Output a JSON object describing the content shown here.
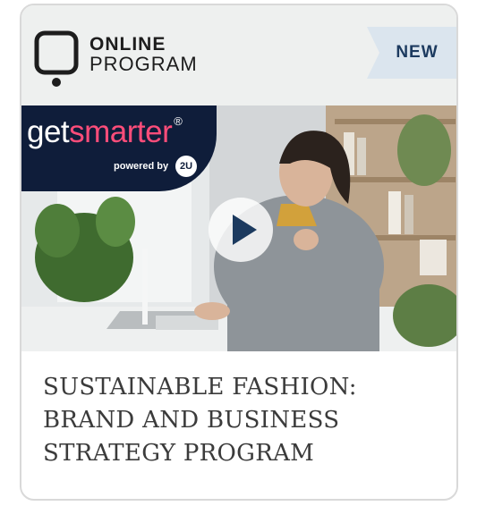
{
  "card": {
    "program_type_line1": "ONLINE",
    "program_type_line2": "PROGRAM",
    "badge": "NEW",
    "brand": {
      "name_part1": "get",
      "name_part2": "smarter",
      "registered": "®",
      "powered_by": "powered by",
      "partner_mark": "2U"
    },
    "play_icon": "play-icon",
    "title_line1": "SUSTAINABLE FASHION:",
    "title_line2": "BRAND AND BUSINESS",
    "title_line3": "STRATEGY PROGRAM"
  },
  "colors": {
    "header_bg": "#eef0ef",
    "badge_bg": "#dbe5ee",
    "badge_text": "#1c3a5f",
    "brand_bg": "#0f1d3a",
    "brand_accent": "#ff4d7a",
    "title_text": "#3b3b3b"
  }
}
